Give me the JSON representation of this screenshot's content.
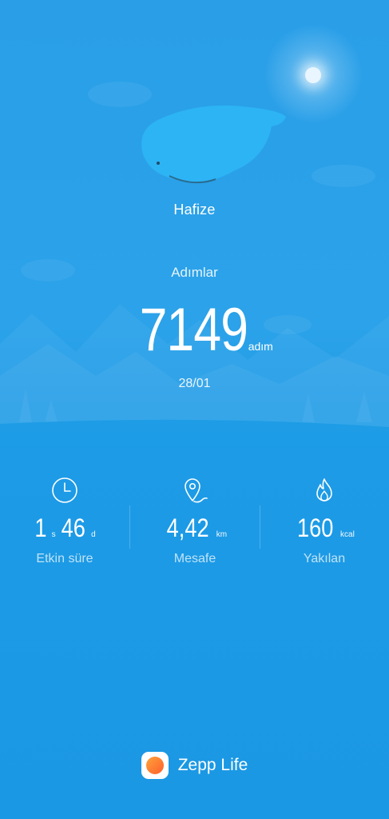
{
  "profile": {
    "name": "Hafize"
  },
  "steps": {
    "label": "Adımlar",
    "value": "7149",
    "unit": "adım",
    "date": "28/01"
  },
  "stats": [
    {
      "icon": "clock-icon",
      "num_a": "1",
      "unit_a": "s",
      "num_b": "46",
      "unit_b": "d",
      "label": "Etkin süre"
    },
    {
      "icon": "location-pin-icon",
      "num": "4,42",
      "unit": "km",
      "label": "Mesafe"
    },
    {
      "icon": "flame-icon",
      "num": "160",
      "unit": "kcal",
      "label": "Yakılan"
    }
  ],
  "brand": {
    "name": "Zepp Life"
  },
  "colors": {
    "background": "#1c9be6",
    "brand_orange": "#ff7a30"
  }
}
